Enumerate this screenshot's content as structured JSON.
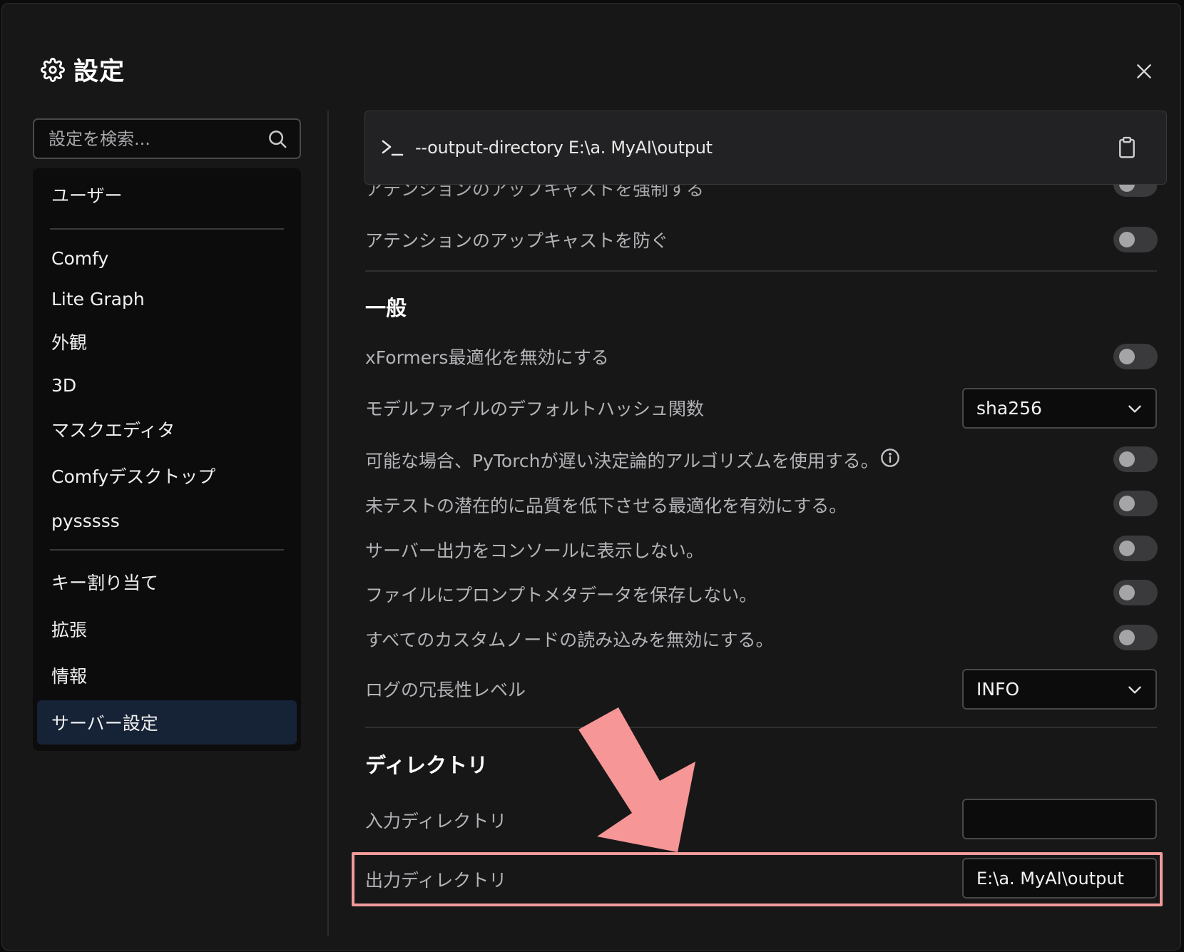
{
  "dialog": {
    "title": "設定",
    "title_icon": "gear-icon",
    "close_icon": "close-icon"
  },
  "search": {
    "placeholder": "設定を検索...",
    "icon": "search-icon"
  },
  "sidebar": {
    "items": [
      {
        "label": "ユーザー"
      },
      {
        "label": "Comfy"
      },
      {
        "label": "Lite Graph"
      },
      {
        "label": "外観"
      },
      {
        "label": "3D"
      },
      {
        "label": "マスクエディタ"
      },
      {
        "label": "Comfyデスクトップ"
      },
      {
        "label": "pysssss"
      },
      {
        "label": "キー割り当て"
      },
      {
        "label": "拡張"
      },
      {
        "label": "情報"
      },
      {
        "label": "サーバー設定",
        "active": true
      }
    ]
  },
  "command": {
    "text": "--output-directory E:\\a. MyAI\\output",
    "prompt_icon": "terminal-prompt-icon",
    "copy_icon": "clipboard-icon"
  },
  "attention": {
    "upcast_force_label": "アテンションのアップキャストを強制する",
    "upcast_prevent_label": "アテンションのアップキャストを防ぐ",
    "upcast_force_on": false,
    "upcast_prevent_on": false
  },
  "general": {
    "title": "一般",
    "xformers_label": "xFormers最適化を無効にする",
    "xformers_on": false,
    "hash_label": "モデルファイルのデフォルトハッシュ関数",
    "hash_value": "sha256",
    "deterministic_label": "可能な場合、PyTorchが遅い決定論的アルゴリズムを使用する。",
    "deterministic_on": false,
    "untested_label": "未テストの潜在的に品質を低下させる最適化を有効にする。",
    "untested_on": false,
    "console_label": "サーバー出力をコンソールに表示しない。",
    "console_on": false,
    "metadata_label": "ファイルにプロンプトメタデータを保存しない。",
    "metadata_on": false,
    "custom_nodes_label": "すべてのカスタムノードの読み込みを無効にする。",
    "custom_nodes_on": false,
    "log_label": "ログの冗長性レベル",
    "log_value": "INFO"
  },
  "directory": {
    "title": "ディレクトリ",
    "input_label": "入力ディレクトリ",
    "input_value": "",
    "output_label": "出力ディレクトリ",
    "output_value": "E:\\a. MyAI\\output"
  },
  "annotation": {
    "arrow_color": "#f79696",
    "highlight_color": "#f29a9a"
  }
}
